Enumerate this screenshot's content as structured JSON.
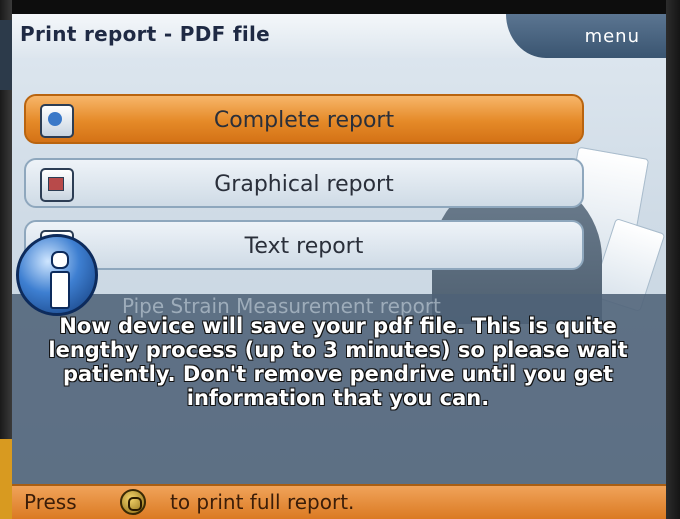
{
  "window": {
    "title": "Print report - PDF file",
    "menu_label": "menu"
  },
  "menu": {
    "items": [
      {
        "label": "Complete report",
        "icon": "complete-report-icon",
        "selected": true
      },
      {
        "label": "Graphical report",
        "icon": "graphical-report-icon",
        "selected": false
      },
      {
        "label": "Text report",
        "icon": "text-report-icon",
        "selected": false
      }
    ],
    "hidden_item_label": "Pipe Strain Measurement report"
  },
  "dialog": {
    "icon": "info-icon",
    "message": "Now device will save your pdf file. This is quite lengthy process (up to 3 minutes) so please wait patiently. Don't remove pendrive until you get information that you can."
  },
  "statusbar": {
    "press_label": "Press",
    "key_icon": "ok-key-icon",
    "hint": "to print full report."
  },
  "colors": {
    "accent_orange": "#e58a28",
    "title_bar": "#dde6ee",
    "menu_tab": "#3a5571",
    "overlay": "#4e6278"
  }
}
